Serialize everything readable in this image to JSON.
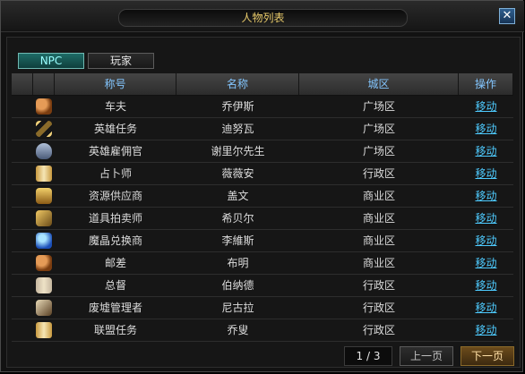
{
  "window": {
    "title": "人物列表"
  },
  "tabs": [
    {
      "label": "NPC",
      "active": true
    },
    {
      "label": "玩家",
      "active": false
    }
  ],
  "table": {
    "headers": [
      "",
      "",
      "称号",
      "名称",
      "城区",
      "操作"
    ],
    "rows": [
      {
        "icon": "round-badge-icon",
        "title": "车夫",
        "name": "乔伊斯",
        "district": "广场区",
        "action": "移动"
      },
      {
        "icon": "crossed-swords-icon",
        "title": "英雄任务",
        "name": "迪努瓦",
        "district": "广场区",
        "action": "移动"
      },
      {
        "icon": "helmet-icon",
        "title": "英雄雇佣官",
        "name": "谢里尔先生",
        "district": "广场区",
        "action": "移动"
      },
      {
        "icon": "scroll-icon",
        "title": "占卜师",
        "name": "薇薇安",
        "district": "行政区",
        "action": "移动"
      },
      {
        "icon": "gold-coins-icon",
        "title": "资源供应商",
        "name": "盖文",
        "district": "商业区",
        "action": "移动"
      },
      {
        "icon": "hammer-icon",
        "title": "道具拍卖师",
        "name": "希贝尔",
        "district": "商业区",
        "action": "移动"
      },
      {
        "icon": "gem-icon",
        "title": "魔晶兑换商",
        "name": "李維斯",
        "district": "商业区",
        "action": "移动"
      },
      {
        "icon": "round-badge-icon",
        "title": "邮差",
        "name": "布明",
        "district": "商业区",
        "action": "移动"
      },
      {
        "icon": "paper-icon",
        "title": "总督",
        "name": "伯纳德",
        "district": "行政区",
        "action": "移动"
      },
      {
        "icon": "tool-icon",
        "title": "废墟管理者",
        "name": "尼古拉",
        "district": "行政区",
        "action": "移动"
      },
      {
        "icon": "quest-icon",
        "title": "联盟任务",
        "name": "乔叟",
        "district": "行政区",
        "action": "移动"
      }
    ]
  },
  "pager": {
    "info": "1 / 3",
    "prev": "上一页",
    "next": "下一页"
  }
}
